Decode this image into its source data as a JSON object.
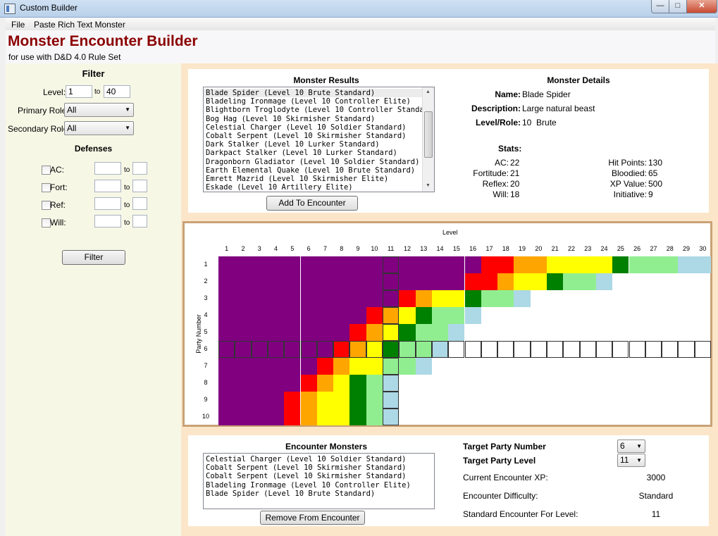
{
  "window": {
    "title": "Custom Builder"
  },
  "menu": [
    {
      "label": "File"
    },
    {
      "label": "Paste Rich Text Monster"
    }
  ],
  "header": {
    "title": "Monster Encounter Builder",
    "subtitle": "for use with D&D 4.0 Rule Set"
  },
  "filter": {
    "title": "Filter",
    "level_label": "Level:",
    "level_from": "1",
    "level_to_label": "to",
    "level_to": "40",
    "primary_role_label": "Primary Role:",
    "primary_role": "All",
    "secondary_role_label": "Secondary Role:",
    "secondary_role": "All",
    "defenses_title": "Defenses",
    "defenses": [
      {
        "label": "AC:"
      },
      {
        "label": "Fort:"
      },
      {
        "label": "Ref:"
      },
      {
        "label": "Will:"
      }
    ],
    "to_label": "to",
    "filter_button": "Filter"
  },
  "results": {
    "title": "Monster Results",
    "items": [
      "Blade Spider (Level 10 Brute Standard)",
      "Bladeling Ironmage (Level 10 Controller Elite)",
      "Blightborn Troglodyte (Level 10 Controller Standard)",
      "Bog Hag (Level 10 Skirmisher Standard)",
      "Celestial Charger (Level 10 Soldier Standard)",
      "Cobalt Serpent (Level 10 Skirmisher Standard)",
      "Dark Stalker (Level 10 Lurker Standard)",
      "Darkpact Stalker (Level 10 Lurker Standard)",
      "Dragonborn Gladiator (Level 10 Soldier Standard)",
      "Earth Elemental Quake (Level 10 Brute Standard)",
      "Emrett Mazrid (Level 10 Skirmisher Elite)",
      "Eskade (Level 10 Artillery Elite)"
    ],
    "add_button": "Add To Encounter"
  },
  "details": {
    "title": "Monster Details",
    "name_label": "Name:",
    "name": "Blade Spider",
    "description_label": "Description:",
    "description": "Large natural beast",
    "level_role_label": "Level/Role:",
    "level_role": "10  Brute",
    "stats_title": "Stats:",
    "stats_left": [
      {
        "label": "AC:",
        "value": "22"
      },
      {
        "label": "Fortitude:",
        "value": "21"
      },
      {
        "label": "Reflex:",
        "value": "20"
      },
      {
        "label": "Will:",
        "value": "18"
      }
    ],
    "stats_right": [
      {
        "label": "Hit Points:",
        "value": "130"
      },
      {
        "label": "Bloodied:",
        "value": "65"
      },
      {
        "label": "XP Value:",
        "value": "500"
      },
      {
        "label": "Initiative:",
        "value": "9"
      }
    ]
  },
  "grid": {
    "x_title": "Level",
    "y_title": "Party Number",
    "levels": [
      "1",
      "2",
      "3",
      "4",
      "5",
      "6",
      "7",
      "8",
      "9",
      "10",
      "11",
      "12",
      "13",
      "14",
      "15",
      "16",
      "17",
      "18",
      "19",
      "20",
      "21",
      "22",
      "23",
      "24",
      "25",
      "26",
      "27",
      "28",
      "29",
      "30"
    ],
    "party": [
      "1",
      "2",
      "3",
      "4",
      "5",
      "6",
      "7",
      "8",
      "9",
      "10"
    ],
    "selected_party": 6,
    "selected_level": 11,
    "colors": {
      "P": "#800080",
      "R": "#ff0000",
      "O": "#ffa500",
      "Y": "#ffff00",
      "G": "#008000",
      "L": "#90ee90",
      "B": "#add8e6"
    },
    "rows": [
      "PPPPPPPPPPPPPPPPRROOYYYYGLLLBB",
      "PPPPPPPPPPPPPPPRROYYGLLB",
      "PPPPPPPPPPPROYYGLLB",
      "PPPPPPPPPROYGLLB",
      "PPPPPPPPROYGLLB",
      "PPPPPPPROYGLLB",
      "PPPPPPROYYLLB",
      "PPPPPROYGLB",
      "PPPPROYYGLB",
      "PPPPROYYGLB"
    ]
  },
  "encounter": {
    "title": "Encounter Monsters",
    "items": [
      "Celestial Charger (Level 10 Soldier Standard)",
      "Cobalt Serpent (Level 10 Skirmisher Standard)",
      "Cobalt Serpent (Level 10 Skirmisher Standard)",
      "Bladeling Ironmage (Level 10 Controller Elite)",
      "Blade Spider (Level 10 Brute Standard)"
    ],
    "remove_button": "Remove From Encounter",
    "target_party_number_label": "Target Party Number",
    "target_party_number": "6",
    "target_party_level_label": "Target Party Level",
    "target_party_level": "11",
    "current_xp_label": "Current Encounter XP:",
    "current_xp": "3000",
    "difficulty_label": "Encounter Difficulty:",
    "difficulty": "Standard",
    "standard_level_label": "Standard Encounter For Level:",
    "standard_level": "11"
  }
}
